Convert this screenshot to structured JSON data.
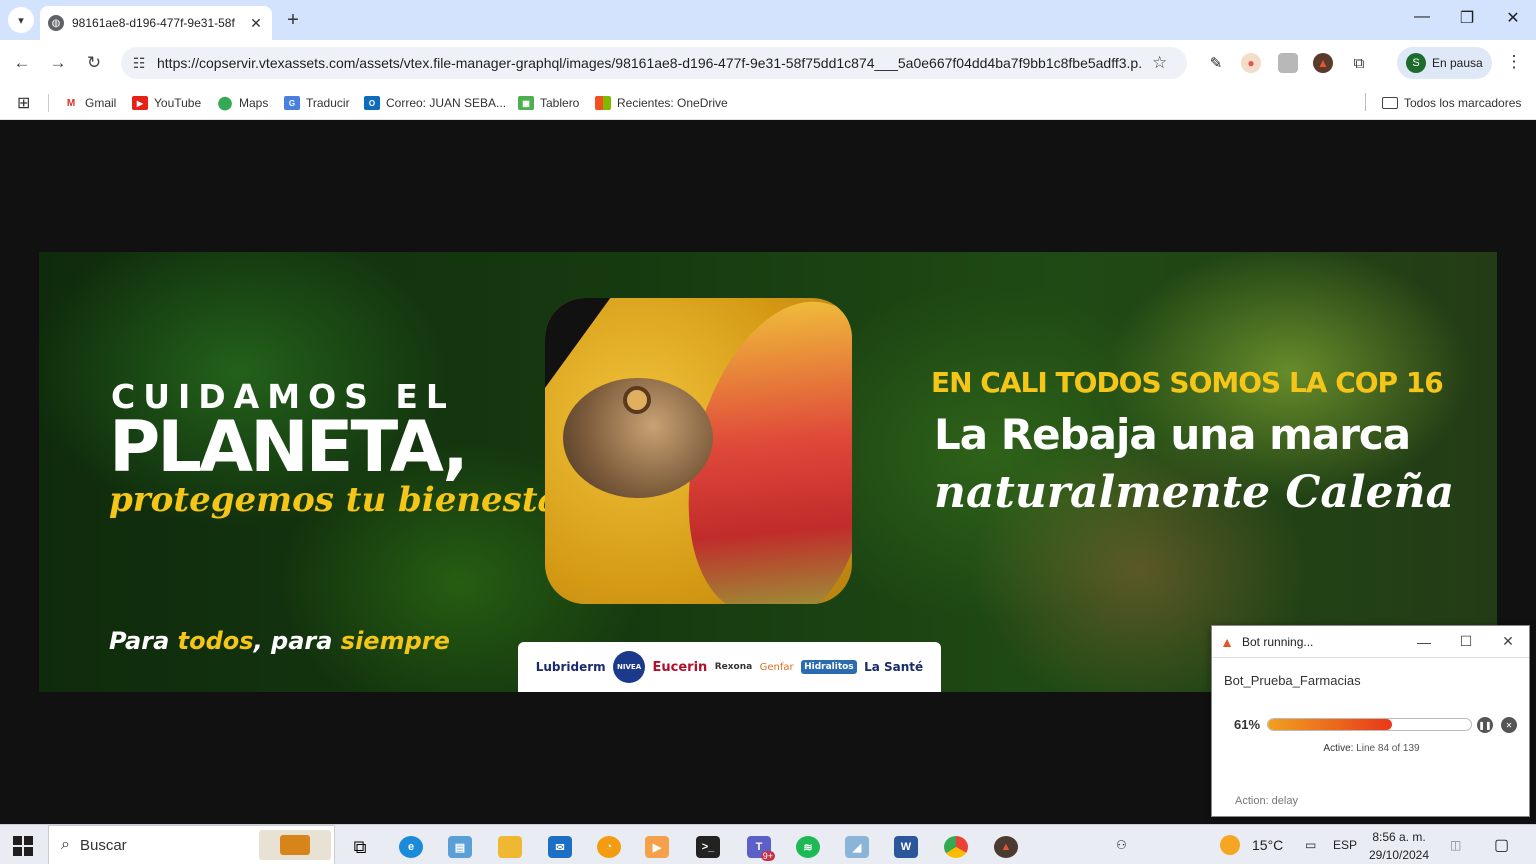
{
  "browser": {
    "tab_title": "98161ae8-d196-477f-9e31-58f",
    "new_tab": "+",
    "url": "https://copservir.vtexassets.com/assets/vtex.file-manager-graphql/images/98161ae8-d196-477f-9e31-58f75dd1c874___5a0e667f04dd4ba7f9bb1c8fbe5adff3.p...",
    "profile_initial": "S",
    "profile_status": "En pausa",
    "bookmarks": [
      {
        "label": "Gmail"
      },
      {
        "label": "YouTube"
      },
      {
        "label": "Maps"
      },
      {
        "label": "Traducir"
      },
      {
        "label": "Correo: JUAN SEBA..."
      },
      {
        "label": "Tablero"
      },
      {
        "label": "Recientes: OneDrive"
      }
    ],
    "all_bookmarks": "Todos los marcadores"
  },
  "banner": {
    "line1": "CUIDAMOS EL",
    "line2": "PLANETA,",
    "line3": "protegemos tu bienestar",
    "footer_a": "Para ",
    "footer_b": "todos",
    "footer_c": ", para ",
    "footer_d": "siempre",
    "right1": "EN CALI TODOS SOMOS LA COP 16",
    "right2": "La Rebaja una marca",
    "right3": "naturalmente Caleña",
    "brands": [
      "Lubriderm",
      "NIVEA",
      "Eucerin",
      "Rexona",
      "Genfar",
      "Hidralitos",
      "La Santé"
    ]
  },
  "bot": {
    "title": "Bot running...",
    "name": "Bot_Prueba_Farmacias",
    "progress_text": "61%",
    "progress": 0.61,
    "active_label": "Active:",
    "active_value": "Line 84 of 139",
    "action": "Action: delay"
  },
  "taskbar": {
    "search": "Buscar",
    "temperature": "15°C",
    "language": "ESP",
    "time": "8:56 a. m.",
    "date": "29/10/2024",
    "teams_badge": "9+"
  }
}
